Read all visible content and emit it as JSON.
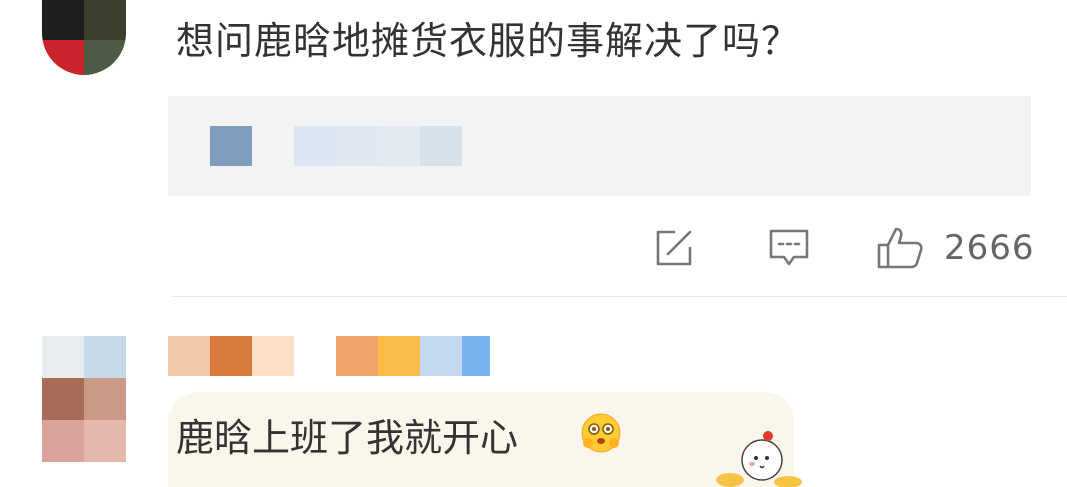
{
  "comments": [
    {
      "text": "想问鹿晗地摊货衣服的事解决了吗？",
      "reply_preview_blurred": true,
      "actions": {
        "share_icon": "share-edit-icon",
        "comment_icon": "comment-bubble-icon",
        "like_icon": "thumb-up-icon",
        "like_count": "2666"
      }
    },
    {
      "username_blurred": true,
      "text": "鹿晗上班了我就开心",
      "emoji": "hugging-face-emoji",
      "bubble_decoration": "fortune-doll-sticker"
    }
  ],
  "colors": {
    "text": "#333333",
    "meta": "#666666",
    "reply_bg": "#f3f3f3",
    "bubble_bg": "#fbf6ec",
    "divider": "#e6e6e6"
  }
}
